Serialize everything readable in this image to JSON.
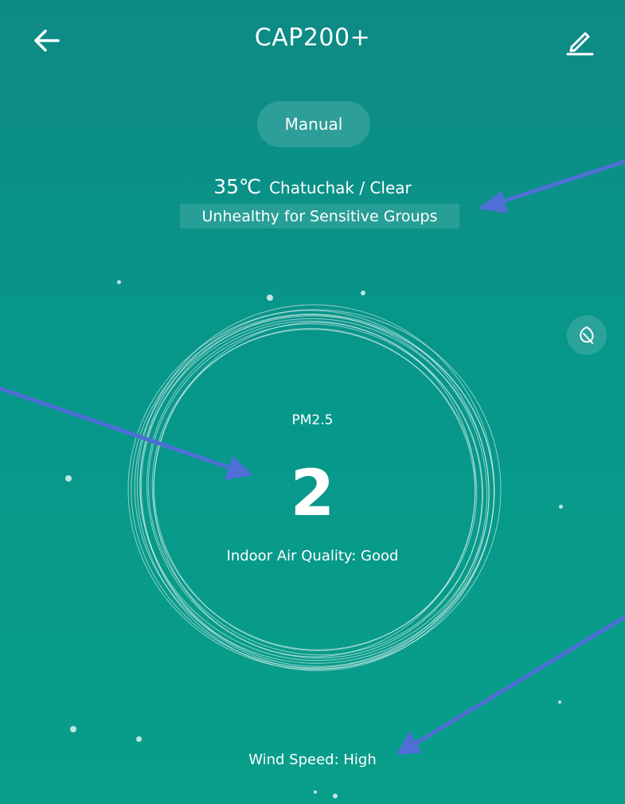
{
  "header": {
    "title": "CAP200+"
  },
  "mode": {
    "label": "Manual"
  },
  "weather": {
    "temperature": "35℃",
    "location_condition": "Chatuchak / Clear",
    "outdoor_air_quality": "Unhealthy for Sensitive Groups"
  },
  "indoor": {
    "metric_label": "PM2.5",
    "metric_value": "2",
    "quality_text": "Indoor Air Quality: Good"
  },
  "fan": {
    "wind_speed_text": "Wind Speed: High"
  },
  "colors": {
    "background_top": "#0e8a85",
    "background_bottom": "#089e8a",
    "text": "#ffffff",
    "annotation_arrow": "#4f6fd6"
  },
  "icons": {
    "back": "back-arrow-icon",
    "edit": "pencil-icon",
    "leaf": "leaf-icon"
  }
}
